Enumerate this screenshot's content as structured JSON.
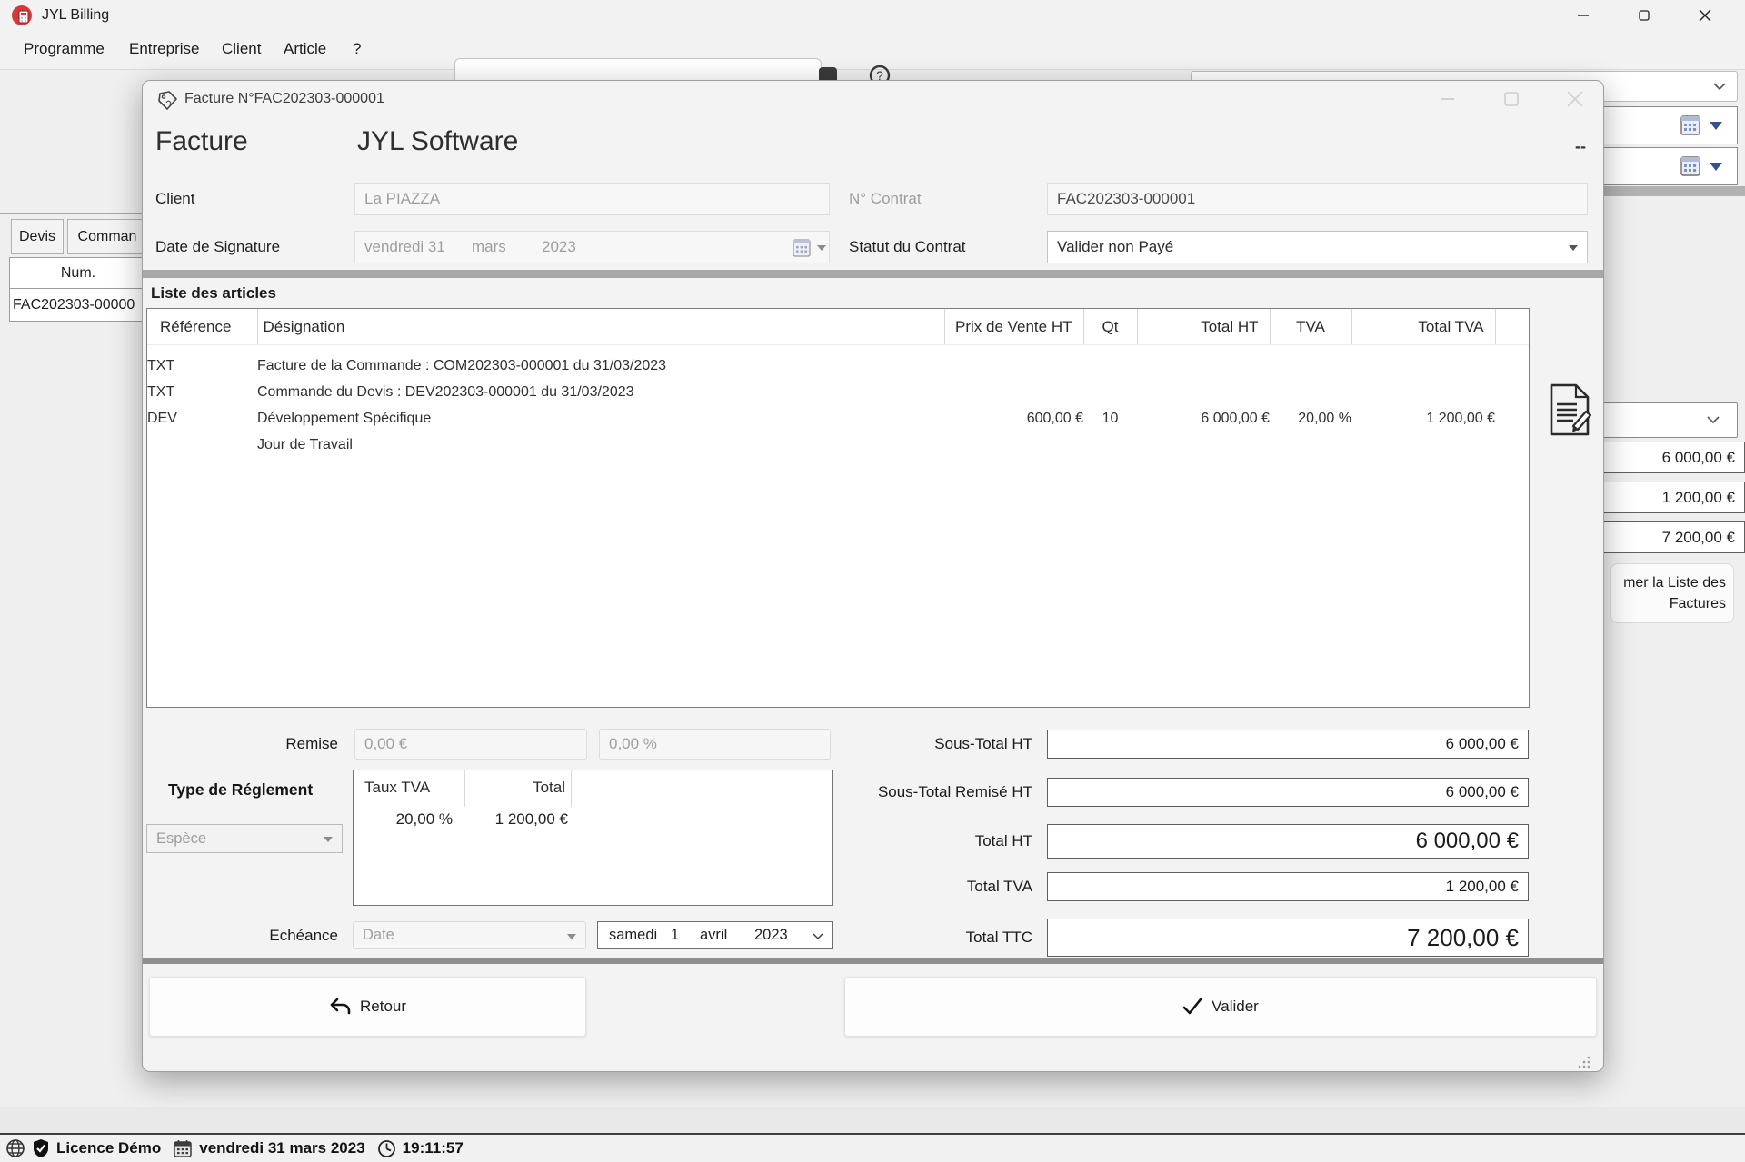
{
  "window": {
    "title": "JYL Billing"
  },
  "menu": {
    "items": [
      "Programme",
      "Entreprise",
      "Client",
      "Article",
      "?"
    ]
  },
  "background": {
    "tabs": {
      "devis": "Devis",
      "commandes": "Comman"
    },
    "num_header": "Num.",
    "num_row": "FAC202303-00000",
    "side": {
      "values": [
        "6 000,00 €",
        "1 200,00 €",
        "7 200,00 €"
      ],
      "button_line1": "mer la Liste des",
      "button_line2": "Factures"
    }
  },
  "statusbar": {
    "licence": "Licence Démo",
    "date": "vendredi 31 mars 2023",
    "time": "19:11:57"
  },
  "dialog": {
    "title": "Facture N°FAC202303-000001",
    "heading": "Facture",
    "company": "JYL Software",
    "dash": "--",
    "fields": {
      "client_label": "Client",
      "client_value": "La PIAZZA",
      "contract_label": "N° Contrat",
      "contract_value": "FAC202303-000001",
      "date_label": "Date de Signature",
      "date_main": "vendredi 31",
      "date_month": "mars",
      "date_year": "2023",
      "status_label": "Statut du Contrat",
      "status_value": "Valider non Payé"
    },
    "articles": {
      "section_title": "Liste des articles",
      "columns": [
        "Référence",
        "Désignation",
        "Prix de Vente HT",
        "Qt",
        "Total HT",
        "TVA",
        "Total TVA"
      ],
      "rows": [
        {
          "ref": "TXT",
          "designation": "Facture de la Commande : COM202303-000001 du 31/03/2023",
          "price": "",
          "qty": "",
          "total_ht": "",
          "tva": "",
          "total_tva": ""
        },
        {
          "ref": "TXT",
          "designation": "Commande du Devis : DEV202303-000001 du 31/03/2023",
          "price": "",
          "qty": "",
          "total_ht": "",
          "tva": "",
          "total_tva": ""
        },
        {
          "ref": "DEV",
          "designation": "Développement Spécifique",
          "price": "600,00 €",
          "qty": "10",
          "total_ht": "6 000,00 €",
          "tva": "20,00 %",
          "total_tva": "1 200,00 €"
        },
        {
          "ref": "",
          "designation": "Jour de Travail",
          "price": "",
          "qty": "",
          "total_ht": "",
          "tva": "",
          "total_tva": ""
        }
      ]
    },
    "remise": {
      "label": "Remise",
      "amount": "0,00 €",
      "percent": "0,00 %"
    },
    "payment": {
      "label": "Type de Réglement",
      "method": "Espèce",
      "tva_col1": "Taux TVA",
      "tva_col2": "Total",
      "tva_rate": "20,00 %",
      "tva_total": "1 200,00 €"
    },
    "echeance": {
      "label": "Echéance",
      "type": "Date",
      "dow": "samedi",
      "day": "1",
      "month": "avril",
      "year": "2023"
    },
    "totals": [
      {
        "label": "Sous-Total HT",
        "value": "6 000,00 €"
      },
      {
        "label": "Sous-Total Remisé HT",
        "value": "6 000,00 €"
      },
      {
        "label": "Total HT",
        "value": "6 000,00 €"
      },
      {
        "label": "Total TVA",
        "value": "1 200,00 €"
      },
      {
        "label": "Total TTC",
        "value": "7 200,00 €"
      }
    ],
    "buttons": {
      "back": "Retour",
      "validate": "Valider"
    }
  }
}
